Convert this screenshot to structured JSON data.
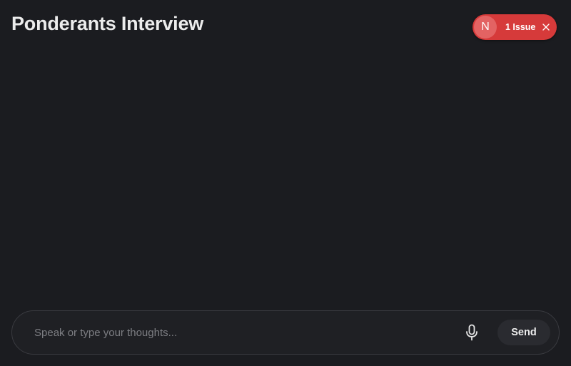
{
  "header": {
    "title": "Ponderants Interview"
  },
  "issue_badge": {
    "avatar_letter": "N",
    "label": "1 Issue",
    "close_icon": "close-icon",
    "color": "#d63a3a"
  },
  "composer": {
    "placeholder": "Speak or type your thoughts...",
    "value": "",
    "mic_icon": "microphone-icon",
    "send_label": "Send"
  },
  "theme": {
    "background": "#1b1c20",
    "accent": "#d63a3a"
  }
}
